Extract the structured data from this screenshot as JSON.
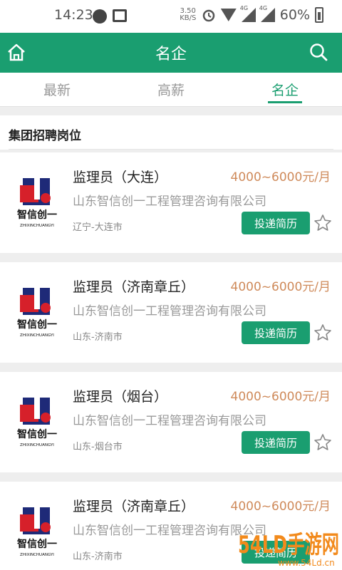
{
  "status_bar": {
    "time": "14:23",
    "speed_value": "3.50",
    "speed_unit": "KB/S",
    "net1": "4G",
    "net2": "4G",
    "battery": "60%"
  },
  "app_bar": {
    "title": "名企",
    "home_icon": "home-icon",
    "search_icon": "search-icon",
    "color": "#1a9e70"
  },
  "tabs": [
    {
      "label": "最新",
      "active": false
    },
    {
      "label": "高薪",
      "active": false
    },
    {
      "label": "名企",
      "active": true
    }
  ],
  "section": {
    "title": "集团招聘岗位"
  },
  "jobs": [
    {
      "title": "监理员（大连）",
      "salary": "4000~6000元/月",
      "company": "山东智信创一工程管理咨询有限公司",
      "location": "辽宁-大连市",
      "apply_label": "投递简历"
    },
    {
      "title": "监理员（济南章丘）",
      "salary": "4000~6000元/月",
      "company": "山东智信创一工程管理咨询有限公司",
      "location": "山东-济南市",
      "apply_label": "投递简历"
    },
    {
      "title": "监理员（烟台）",
      "salary": "4000~6000元/月",
      "company": "山东智信创一工程管理咨询有限公司",
      "location": "山东-烟台市",
      "apply_label": "投递简历"
    },
    {
      "title": "监理员（济南章丘）",
      "salary": "4000~6000元/月",
      "company": "山东智信创一工程管理咨询有限公司",
      "location": "山东-济南市",
      "apply_label": "投递简历"
    }
  ],
  "logo": {
    "brand": "智信创一",
    "pinyin": "ZHIXINCHUANGYI"
  },
  "watermark": {
    "text": "54LD手游网",
    "sub": "www.54Ld.cn"
  }
}
